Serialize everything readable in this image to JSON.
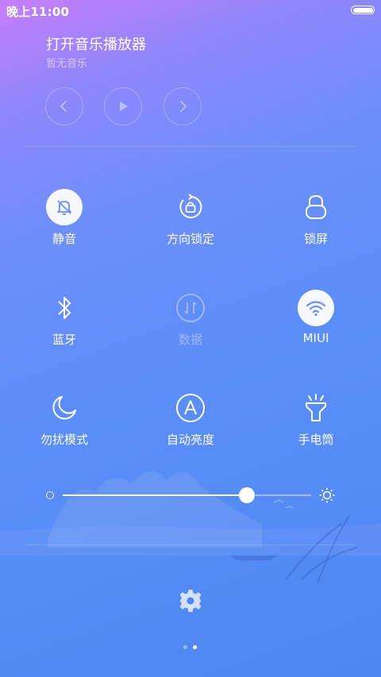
{
  "status_bar": {
    "time": "晚上11:00"
  },
  "music": {
    "title": "打开音乐播放器",
    "subtitle": "暂无音乐",
    "controls": [
      "previous-icon",
      "play-icon",
      "next-icon"
    ]
  },
  "toggles": [
    {
      "label": "静音",
      "icon": "bell-off-icon",
      "active": true
    },
    {
      "label": "方向锁定",
      "icon": "rotation-lock-icon",
      "active": false
    },
    {
      "label": "锁屏",
      "icon": "lock-icon",
      "active": false
    },
    {
      "label": "蓝牙",
      "icon": "bluetooth-icon",
      "active": false
    },
    {
      "label": "数据",
      "icon": "mobile-data-icon",
      "active": false,
      "disabled": true
    },
    {
      "label": "MIUI",
      "icon": "wifi-icon",
      "active": true
    },
    {
      "label": "勿扰模式",
      "icon": "moon-icon",
      "active": false
    },
    {
      "label": "自动亮度",
      "icon": "auto-brightness-icon",
      "active": false
    },
    {
      "label": "手电筒",
      "icon": "flashlight-icon",
      "active": false
    }
  ],
  "brightness": {
    "level": 0.74
  },
  "pager": {
    "pages": 2,
    "current": 2
  },
  "colors": {
    "accent": "#4f86f2",
    "active_icon": "#6f8ef8"
  }
}
